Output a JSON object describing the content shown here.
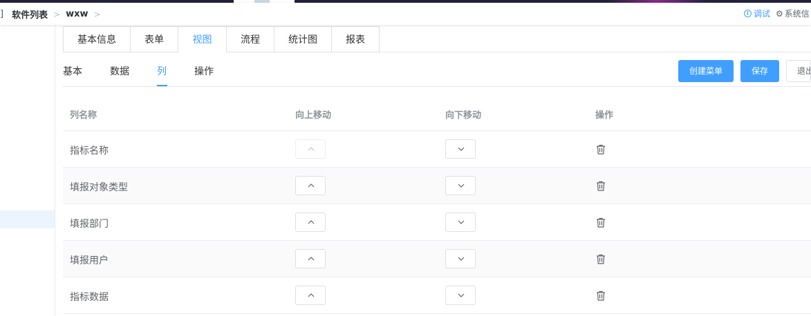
{
  "breadcrumb": {
    "bracket": "]",
    "items": [
      "软件列表",
      "wxw"
    ]
  },
  "header": {
    "debug_label": "调试",
    "system_label": "系统信"
  },
  "main_tabs": [
    {
      "label": "基本信息",
      "active": false
    },
    {
      "label": "表单",
      "active": false
    },
    {
      "label": "视图",
      "active": true
    },
    {
      "label": "流程",
      "active": false
    },
    {
      "label": "统计图",
      "active": false
    },
    {
      "label": "报表",
      "active": false
    }
  ],
  "sub_tabs": [
    {
      "label": "基本",
      "active": false
    },
    {
      "label": "数据",
      "active": false
    },
    {
      "label": "列",
      "active": true
    },
    {
      "label": "操作",
      "active": false
    }
  ],
  "toolbar": {
    "create_menu_label": "创建菜单",
    "save_label": "保存",
    "exit_label": "退出"
  },
  "table": {
    "headers": {
      "name": "列名称",
      "move_up": "向上移动",
      "move_down": "向下移动",
      "actions": "操作"
    },
    "rows": [
      {
        "name": "指标名称",
        "up_disabled": true
      },
      {
        "name": "填报对象类型",
        "up_disabled": false
      },
      {
        "name": "填报部门",
        "up_disabled": false
      },
      {
        "name": "填报用户",
        "up_disabled": false
      },
      {
        "name": "指标数据",
        "up_disabled": false
      }
    ]
  },
  "icons": {
    "move_up": "chevron-up-icon",
    "move_down": "chevron-down-icon",
    "delete": "trash-icon",
    "debug": "info-circle-icon",
    "system": "gear-icon"
  },
  "colors": {
    "accent": "#409eff",
    "stripe": "#fafafa"
  }
}
